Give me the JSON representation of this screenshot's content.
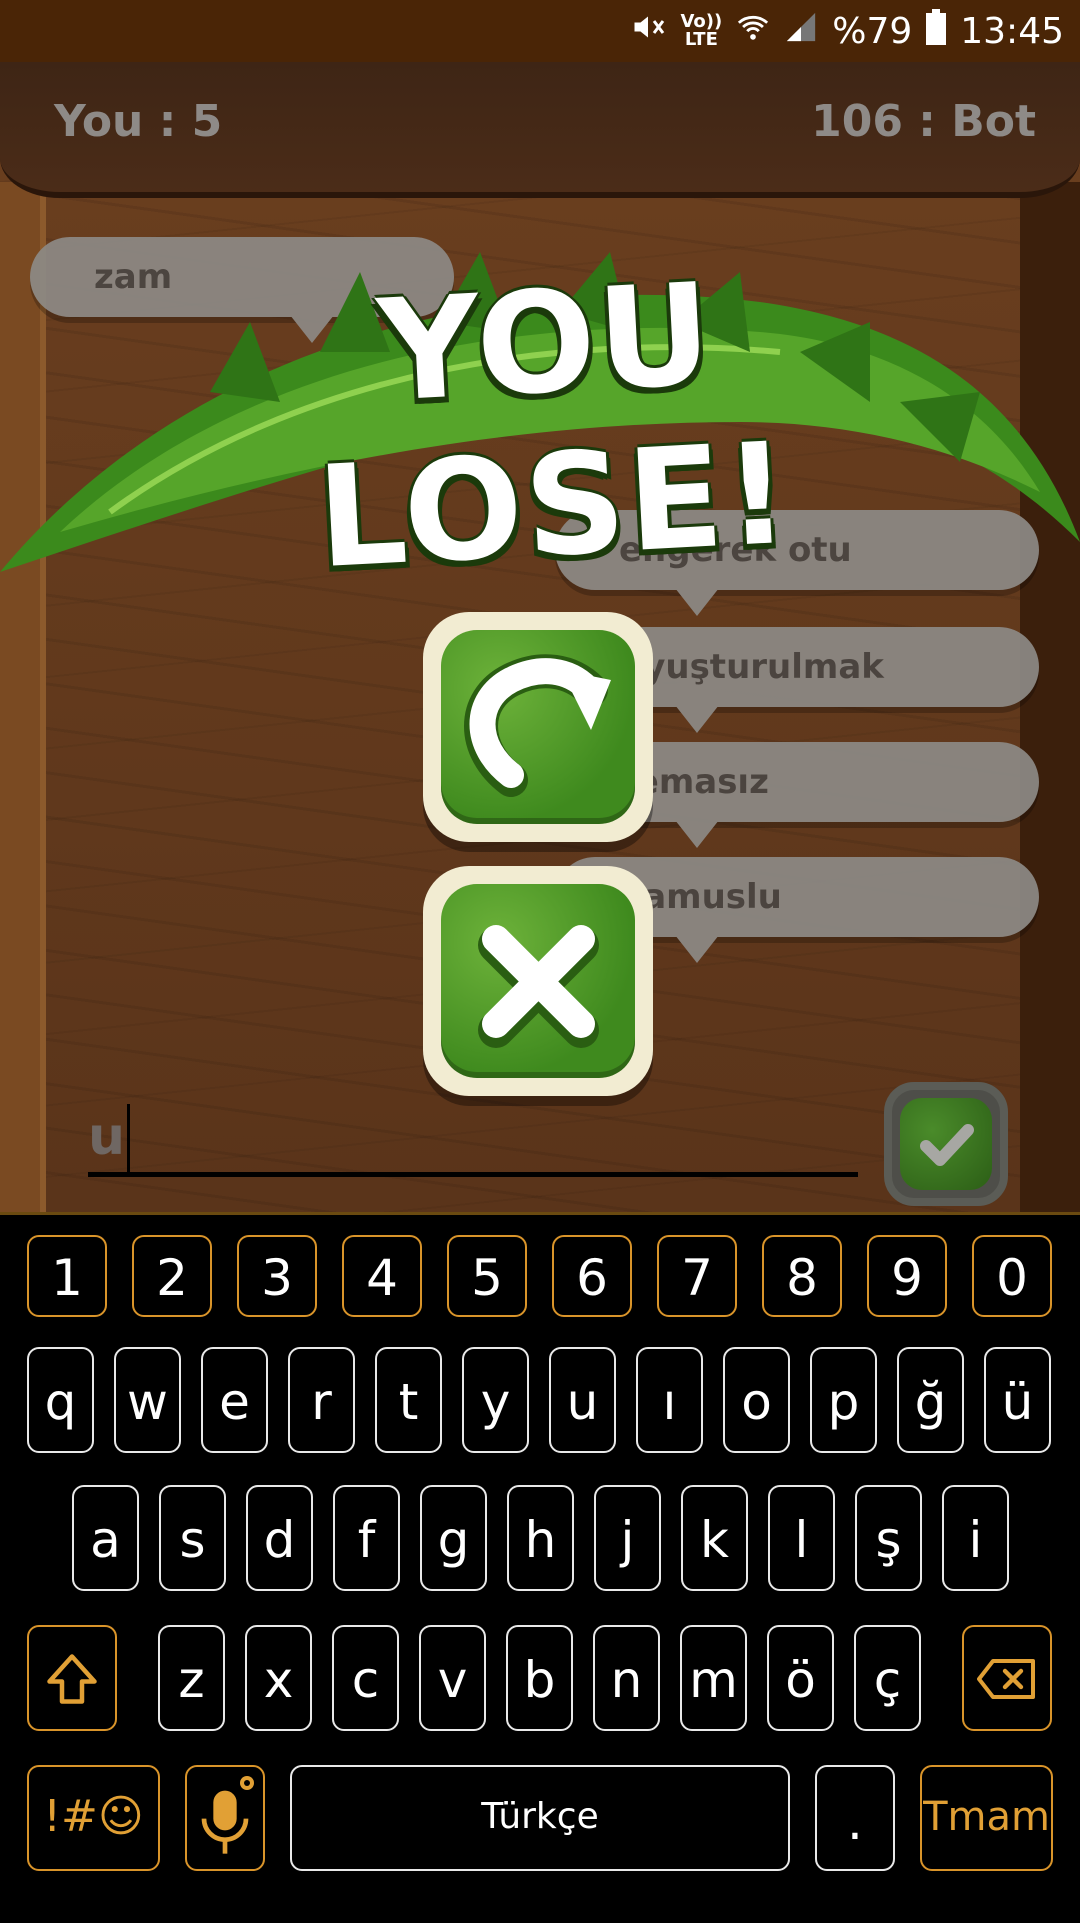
{
  "status_bar": {
    "battery_percent": "%79",
    "time": "13:45",
    "lte_top": "Vo))",
    "lte_bottom": "LTE",
    "icons": [
      "mute-icon",
      "lte-icon",
      "wifi-icon",
      "signal-icon",
      "battery-icon"
    ]
  },
  "scores": {
    "you": "You :  5",
    "bot": "106 : Bot"
  },
  "bubbles": {
    "left_top": "zam",
    "right_1": "engerek otu",
    "right_2": "uyuşturulmak",
    "right_3": "remasız",
    "right_4": "namuslu"
  },
  "result": {
    "title": "YOU LOSE!"
  },
  "input": {
    "value": "u"
  },
  "keyboard": {
    "numbers": [
      "1",
      "2",
      "3",
      "4",
      "5",
      "6",
      "7",
      "8",
      "9",
      "0"
    ],
    "row1": [
      "q",
      "w",
      "e",
      "r",
      "t",
      "y",
      "u",
      "ı",
      "o",
      "p",
      "ğ",
      "ü"
    ],
    "row2": [
      "a",
      "s",
      "d",
      "f",
      "g",
      "h",
      "j",
      "k",
      "l",
      "ş",
      "i"
    ],
    "row3": [
      "z",
      "x",
      "c",
      "v",
      "b",
      "n",
      "m",
      "ö",
      "ç"
    ],
    "symbols_label": "!#☺",
    "space_label": "Türkçe",
    "period_label": ".",
    "done_label": "Tmam"
  },
  "colors": {
    "accent_orange": "#e1a035",
    "leaf_green": "#3f8a1e",
    "wood_brown": "#5a341a"
  }
}
